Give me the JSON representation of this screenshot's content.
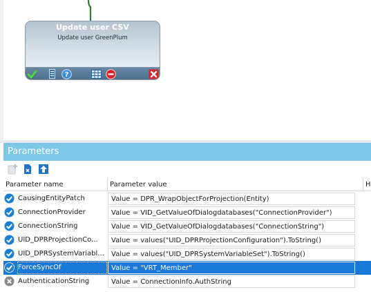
{
  "activity": {
    "title": "Update user CSV",
    "subtitle": "Update user GreenPlum"
  },
  "parameters": {
    "header": "Parameters",
    "columns": {
      "name": "Parameter name",
      "value": "Parameter value",
      "extra": "H"
    },
    "rows": [
      {
        "name": "CausingEntityPatch",
        "value": "Value = DPR_WrapObjectForProjection(Entity)",
        "status": "ok"
      },
      {
        "name": "ConnectionProvider",
        "value": "Value = VID_GetValueOfDialogdatabases(\"ConnectionProvider\")",
        "status": "ok"
      },
      {
        "name": "ConnectionString",
        "value": "Value = VID_GetValueOfDialogdatabases(\"ConnectionString\")",
        "status": "ok"
      },
      {
        "name": "UID_DPRProjectionCo...",
        "value": "Value = values(\"UID_DPRProjectionConfiguration\").ToString()",
        "status": "ok"
      },
      {
        "name": "UID_DPRSystemVariabl...",
        "value": "Value = values(\"UID_DPRSystemVariableSet\").ToString()",
        "status": "ok"
      },
      {
        "name": "ForceSyncOf",
        "value": "Value = \"VRT_Member\"",
        "status": "ok"
      },
      {
        "name": "AuthenticationString",
        "value": "Value = ConnectionInfo.AuthString",
        "status": "empty"
      }
    ]
  },
  "colors": {
    "header_bg": "#7cc8e6",
    "selected_bg": "#1a78d6",
    "check_blue": "#1a7fd6",
    "connector_green": "#2d7a2d"
  }
}
